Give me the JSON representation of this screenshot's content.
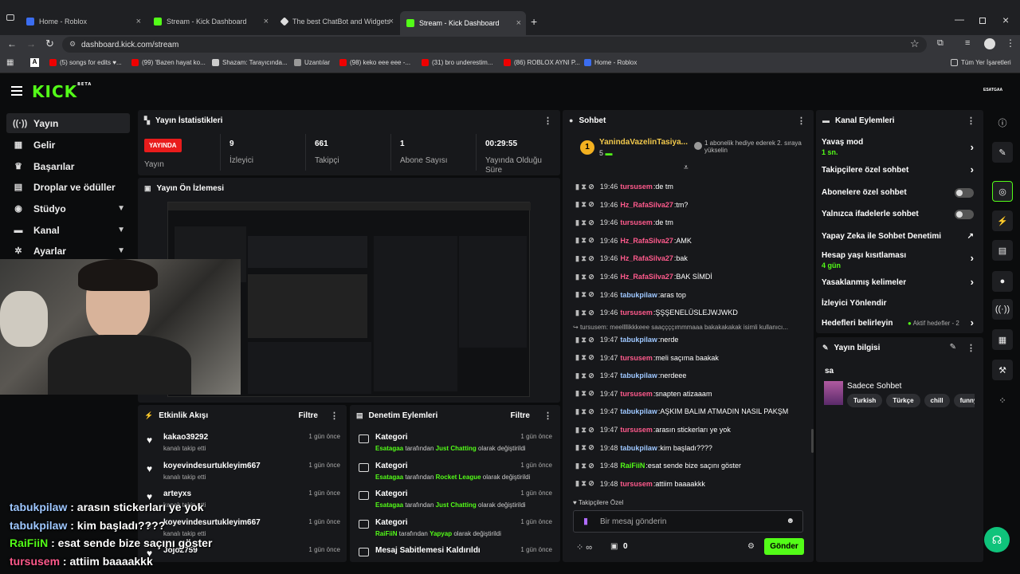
{
  "browser": {
    "tabs": [
      {
        "title": "Home - Roblox",
        "color": "#3b6df0"
      },
      {
        "title": "Stream - Kick Dashboard",
        "color": "#53fc18"
      },
      {
        "title": "The best ChatBot and Widgets",
        "color": "#ddd"
      },
      {
        "title": "Stream - Kick Dashboard",
        "color": "#53fc18"
      }
    ],
    "url": "dashboard.kick.com/stream",
    "bookmarks": [
      "(5) songs for edits ♥...",
      "(99) 'Bazen hayat ko...",
      "Shazam: Tarayıcında...",
      "Uzantılar",
      "(98) keko eee eee -...",
      "(31) bro underestim...",
      "(86) ROBLOX AYNI P...",
      "Home - Roblox"
    ],
    "all_bookmarks": "Tüm Yer İşaretleri"
  },
  "header": {
    "logo": "KICK",
    "logo_sup": "BETA",
    "username": "ESATGAA"
  },
  "sidebar": {
    "items": [
      {
        "label": "Yayın",
        "icon": "((·))"
      },
      {
        "label": "Gelir",
        "icon": "▦"
      },
      {
        "label": "Başarılar",
        "icon": "♛"
      },
      {
        "label": "Droplar ve ödüller",
        "icon": "▤"
      },
      {
        "label": "Stüdyo",
        "icon": "◉"
      },
      {
        "label": "Kanal",
        "icon": "▬"
      },
      {
        "label": "Ayarlar",
        "icon": "✲"
      }
    ]
  },
  "stats": {
    "title": "Yayın İstatistikleri",
    "live_badge": "YAYINDA",
    "live_label": "Yayın",
    "viewers_value": "9",
    "viewers_label": "İzleyici",
    "followers_value": "661",
    "followers_label": "Takipçi",
    "subs_value": "1",
    "subs_label": "Abone Sayısı",
    "uptime_value": "00:29:55",
    "uptime_label": "Yayında Olduğu Süre"
  },
  "preview": {
    "title": "Yayın Ön İzlemesi"
  },
  "activity": {
    "title": "Etkinlik Akışı",
    "filter": "Filtre",
    "items": [
      {
        "user": "kakao39292",
        "action": "kanalı takip etti",
        "time": "1 gün önce"
      },
      {
        "user": "koyevindesurtukleyim667",
        "action": "kanalı takip etti",
        "time": "1 gün önce"
      },
      {
        "user": "arteyxs",
        "action": "kanalı takip etti",
        "time": "1 gün önce"
      },
      {
        "user": "koyevindesurtukleyim667",
        "action": "kanalı takip etti",
        "time": "1 gün önce"
      },
      {
        "user": "Jojo2759",
        "action": "",
        "time": "1 gün önce"
      }
    ]
  },
  "moderation": {
    "title": "Denetim Eylemleri",
    "filter": "Filtre",
    "items": [
      {
        "title": "Kategori",
        "actor": "Esatagaa",
        "mid": "tarafından",
        "target": "Just Chatting",
        "tail": "olarak değiştirildi",
        "time": "1 gün önce"
      },
      {
        "title": "Kategori",
        "actor": "Esatagaa",
        "mid": "tarafından",
        "target": "Rocket League",
        "tail": "olarak değiştirildi",
        "time": "1 gün önce"
      },
      {
        "title": "Kategori",
        "actor": "Esatagaa",
        "mid": "tarafından",
        "target": "Just Chatting",
        "tail": "olarak değiştirildi",
        "time": "1 gün önce"
      },
      {
        "title": "Kategori",
        "actor": "RaiFiiN",
        "mid": "tarafından",
        "target": "Yapyap",
        "tail": "olarak değiştirildi",
        "time": "1 gün önce"
      },
      {
        "title": "Mesaj Sabitlemesi Kaldırıldı",
        "actor": "",
        "mid": "",
        "target": "",
        "tail": "",
        "time": "1 gün önce"
      }
    ]
  },
  "chat": {
    "title": "Sohbet",
    "top_user": "YanindaVazelinTasiya...",
    "top_user_count": "5",
    "gift_note": "1 abonelik hediye ederek 2. sıraya yükselin",
    "reply_preview": "tursusem: meellllikkkeee saaççççımmmaaa bakakakakak isimli kullanıcı...",
    "messages": [
      {
        "time": "19:46",
        "user": "tursusem",
        "color": "#ff5a8c",
        "text": "de tm"
      },
      {
        "time": "19:46",
        "user": "Hz_RafaSilva27",
        "color": "#ff5a8c",
        "text": "tm?"
      },
      {
        "time": "19:46",
        "user": "tursusem",
        "color": "#ff5a8c",
        "text": "de tm"
      },
      {
        "time": "19:46",
        "user": "Hz_RafaSilva27",
        "color": "#ff5a8c",
        "text": "AMK"
      },
      {
        "time": "19:46",
        "user": "Hz_RafaSilva27",
        "color": "#ff5a8c",
        "text": "bak"
      },
      {
        "time": "19:46",
        "user": "Hz_RafaSilva27",
        "color": "#ff5a8c",
        "text": "BAK SİMDİ"
      },
      {
        "time": "19:46",
        "user": "tabukpilaw",
        "color": "#9ec7ff",
        "text": "aras top"
      },
      {
        "time": "19:46",
        "user": "tursusem",
        "color": "#ff5a8c",
        "text": "ŞŞŞENELÜSLEJWJWKD"
      },
      {
        "time": "19:47",
        "user": "tabukpilaw",
        "color": "#9ec7ff",
        "text": "nerde"
      },
      {
        "time": "19:47",
        "user": "tursusem",
        "color": "#ff5a8c",
        "text": "meli saçıma baakak"
      },
      {
        "time": "19:47",
        "user": "tabukpilaw",
        "color": "#9ec7ff",
        "text": "nerdeee"
      },
      {
        "time": "19:47",
        "user": "tursusem",
        "color": "#ff5a8c",
        "text": "snapten atizaaam"
      },
      {
        "time": "19:47",
        "user": "tabukpilaw",
        "color": "#9ec7ff",
        "text": "AŞKIM BALIM ATMADIN NASIL PAKŞM"
      },
      {
        "time": "19:47",
        "user": "tursusem",
        "color": "#ff5a8c",
        "text": "arasın stickerları ye yok"
      },
      {
        "time": "19:48",
        "user": "tabukpilaw",
        "color": "#9ec7ff",
        "text": "kim başladı????"
      },
      {
        "time": "19:48",
        "user": "RaiFiiN",
        "color": "#53fc18",
        "text": "esat sende bize saçını göster"
      },
      {
        "time": "19:48",
        "user": "tursusem",
        "color": "#ff5a8c",
        "text": "attiim baaaakkk"
      }
    ],
    "followers_only": "Takipçilere Özel",
    "placeholder": "Bir mesaj gönderin",
    "count": "0",
    "send": "Gönder"
  },
  "channel_actions": {
    "title": "Kanal Eylemleri",
    "slow_mode": "Yavaş mod",
    "slow_mode_value": "1 sn.",
    "followers_chat": "Takipçilere özel sohbet",
    "subs_chat": "Abonelere özel sohbet",
    "emote_chat": "Yalnızca ifadelerle sohbet",
    "ai_mod": "Yapay Zeka ile Sohbet Denetimi",
    "account_age": "Hesap yaşı kısıtlaması",
    "account_age_value": "4 gün",
    "banned_words": "Yasaklanmış kelimeler",
    "redirect": "İzleyici Yönlendir",
    "goals": "Hedefleri belirleyin",
    "goals_value": "Aktif hedefler - 2"
  },
  "stream_info": {
    "title": "Yayın bilgisi",
    "stream_title": "sa",
    "category": "Sadece Sohbet",
    "tags": [
      "Turkish",
      "Türkçe",
      "chill",
      "funny"
    ]
  },
  "overlay_chat": [
    {
      "user": "tabukpilaw",
      "text": ": arasın stickerları ye yok",
      "color": "#9ec7ff"
    },
    {
      "user": "tabukpilaw",
      "text": ": kim başladı????",
      "color": "#9ec7ff"
    },
    {
      "user": "RaiFiiN",
      "text": ": esat sende bize saçını göster",
      "color": "#53fc18"
    },
    {
      "user": "tursusem",
      "text": ": attiim baaaakkk",
      "color": "#ff5a8c"
    }
  ]
}
